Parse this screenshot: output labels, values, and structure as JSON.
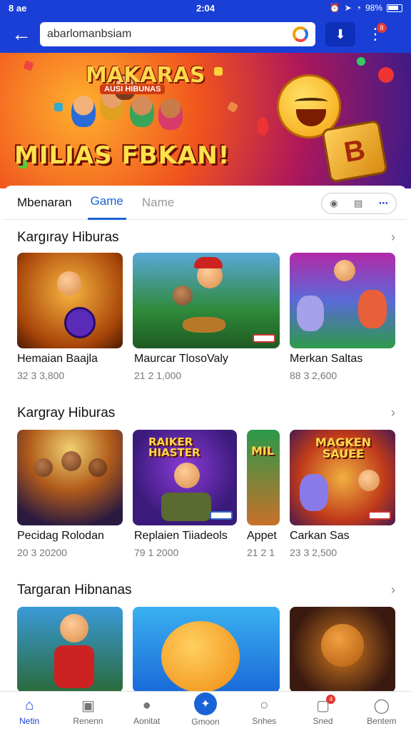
{
  "status_bar": {
    "left": "8 ae",
    "time": "2:04",
    "battery": "98%"
  },
  "app_bar": {
    "search_value": "abarlomanbsiam",
    "badge": "8"
  },
  "banner": {
    "top_title": "MAKARAS",
    "sub_title": "AUSI HIBUNAS",
    "big_title": "MILIAS FBKAN!",
    "cube_letter": "B"
  },
  "tabs": {
    "t1": "Mbenaran",
    "t2": "Game",
    "t3": "Name"
  },
  "sections": [
    {
      "title": "Kargıray Hiburas",
      "items": [
        {
          "name": "Hemaian Baajla",
          "meta": "32 3 3,800"
        },
        {
          "name": "Maurcar TlosoValy",
          "meta": "21 2 1,000"
        },
        {
          "name": "Merkan Saltas",
          "meta": "88 3 2,600"
        }
      ]
    },
    {
      "title": "Kargray Hiburas",
      "items": [
        {
          "name": "Pecidag Rolodan",
          "meta": "20 3 20200",
          "poster": ""
        },
        {
          "name": "Replaien Tiiadeols",
          "meta": "79 1 2000",
          "poster": "RAIKER HIASTER"
        },
        {
          "name": "Appet",
          "meta": "21 2 1",
          "poster": "MIL"
        },
        {
          "name": "Carkan Sas",
          "meta": "23 3 2,500",
          "poster": "MAGKEN SAUEE"
        }
      ]
    },
    {
      "title": "Targaran Hibnanas",
      "items": [
        {},
        {},
        {}
      ]
    }
  ],
  "bottom_nav": [
    {
      "label": "Netin",
      "icon": "home-icon"
    },
    {
      "label": "Renenn",
      "icon": "bag-icon"
    },
    {
      "label": "Aonitat",
      "icon": "chat-icon"
    },
    {
      "label": "Gmoon",
      "icon": "star-icon"
    },
    {
      "label": "Snhes",
      "icon": "search-icon"
    },
    {
      "label": "Sned",
      "icon": "message-icon",
      "badge": "4"
    },
    {
      "label": "Bentem",
      "icon": "person-icon"
    }
  ],
  "colors": {
    "primary": "#1a3fd6",
    "accent": "#1a63d6",
    "badge": "#e53935"
  }
}
